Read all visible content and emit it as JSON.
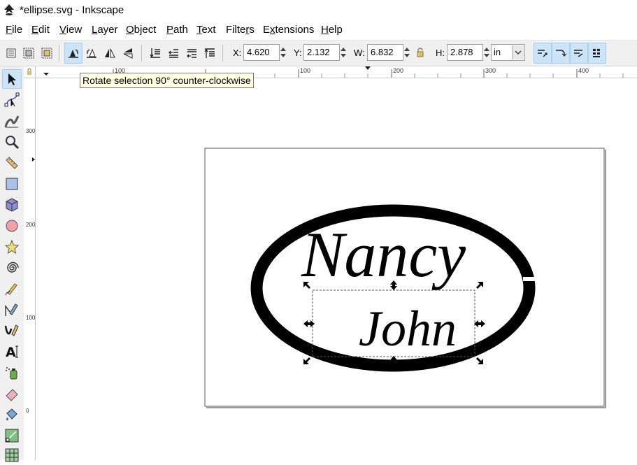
{
  "window": {
    "title": "*ellipse.svg - Inkscape",
    "icon": "inkscape-icon"
  },
  "menu": [
    {
      "label": "File",
      "mnemonic": "F"
    },
    {
      "label": "Edit",
      "mnemonic": "E"
    },
    {
      "label": "View",
      "mnemonic": "V"
    },
    {
      "label": "Layer",
      "mnemonic": "L"
    },
    {
      "label": "Object",
      "mnemonic": "O"
    },
    {
      "label": "Path",
      "mnemonic": "P"
    },
    {
      "label": "Text",
      "mnemonic": "T"
    },
    {
      "label": "Filters",
      "mnemonic": "r"
    },
    {
      "label": "Extensions",
      "mnemonic": "x"
    },
    {
      "label": "Help",
      "mnemonic": "H"
    }
  ],
  "toolbar": {
    "x_label": "X:",
    "x_value": "4.620",
    "y_label": "Y:",
    "y_value": "2.132",
    "w_label": "W:",
    "w_value": "6.832",
    "h_label": "H:",
    "h_value": "2.878",
    "unit": "in"
  },
  "tooltip": "Rotate selection 90° counter-clockwise",
  "ruler": {
    "h_ticks": [
      "100",
      "100",
      "200",
      "300",
      "400"
    ],
    "v_ticks": [
      "300",
      "200",
      "100",
      "0"
    ]
  },
  "canvas_text": {
    "line1": "Nancy",
    "line2": "John"
  },
  "colors": {
    "accent": "#cce4f7",
    "toolbar_bg": "#f0f0f0",
    "ellipse": "#000000"
  }
}
